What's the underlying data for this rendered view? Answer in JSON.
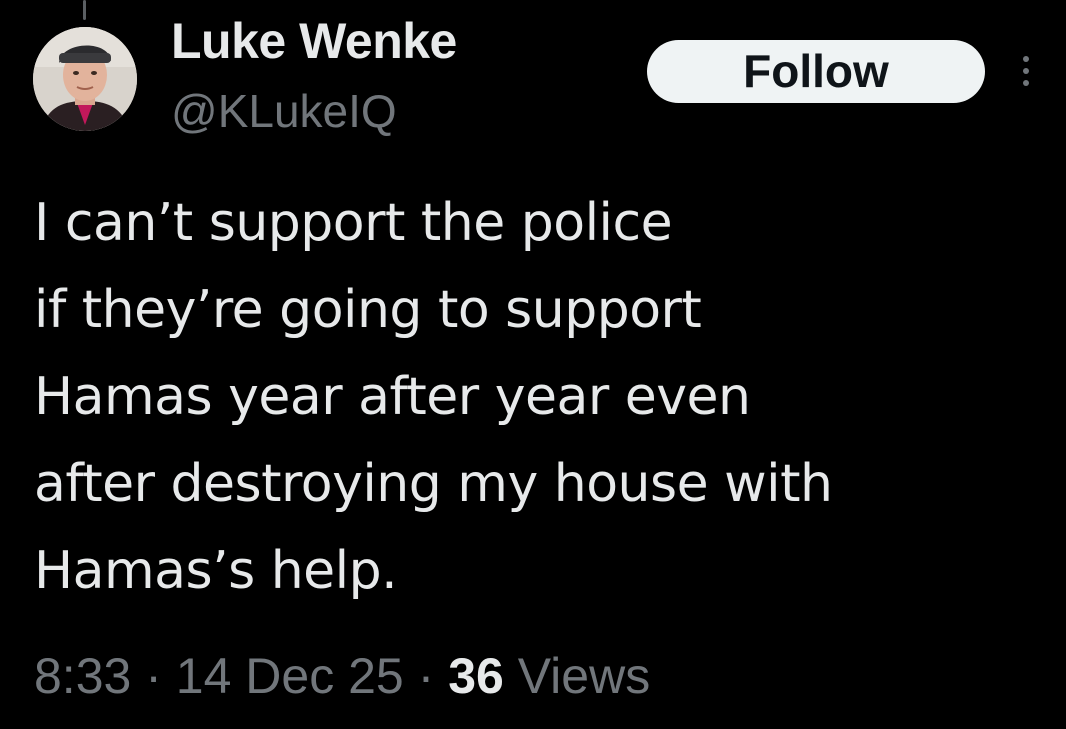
{
  "author": {
    "display_name": "Luke Wenke",
    "handle": "@KLukeIQ",
    "avatar": "profile-photo"
  },
  "actions": {
    "follow_label": "Follow",
    "more_icon": "more-vertical-icon"
  },
  "tweet": {
    "lines": [
      "I can’t support the police",
      "if they’re going to support",
      "Hamas year after year even",
      "after destroying my house with",
      "Hamas’s help."
    ]
  },
  "meta": {
    "time": "8:33",
    "separator": "·",
    "date": "14 Dec 25",
    "views_count": "36",
    "views_label": "Views"
  },
  "colors": {
    "background": "#000000",
    "primary_text": "#e7e9ea",
    "secondary_text": "#71767b",
    "follow_button_bg": "#eff3f4",
    "follow_button_text": "#0f1419"
  }
}
